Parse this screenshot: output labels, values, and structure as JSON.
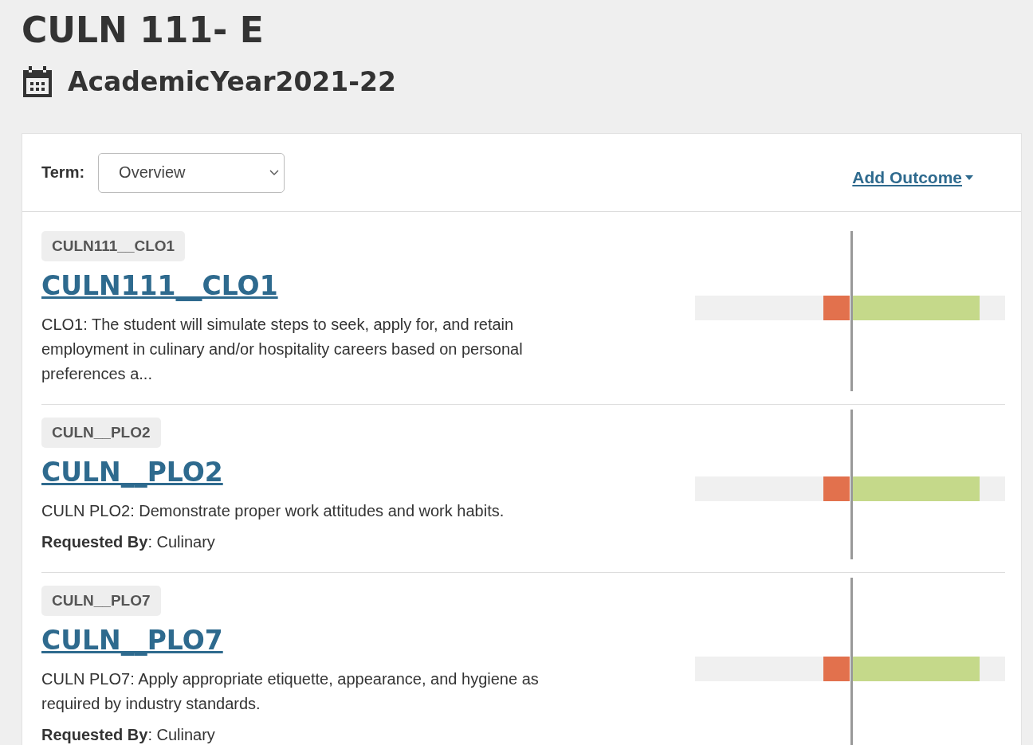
{
  "course_title": "CULN 111- E",
  "academic_year": "AcademicYear2021-22",
  "term": {
    "label": "Term:",
    "value": "Overview"
  },
  "add_outcome": "Add Outcome",
  "outcomes": [
    {
      "tag": "CULN111__CLO1",
      "title": "CULN111__CLO1",
      "description": "CLO1: The student will simulate steps to seek, apply for, and retain employment in culinary and/or hospitality careers based on personal preferences a..."
    },
    {
      "tag": "CULN__PLO2",
      "title": "CULN__PLO2",
      "description": "CULN PLO2: Demonstrate proper work attitudes and work habits.",
      "requested_by": "**Requested By**: Culinary"
    },
    {
      "tag": "CULN__PLO7",
      "title": "CULN__PLO7",
      "description": "CULN PLO7: Apply appropriate etiquette, appearance, and hygiene as required by industry standards.",
      "requested_by": "**Requested By**: Culinary"
    }
  ]
}
